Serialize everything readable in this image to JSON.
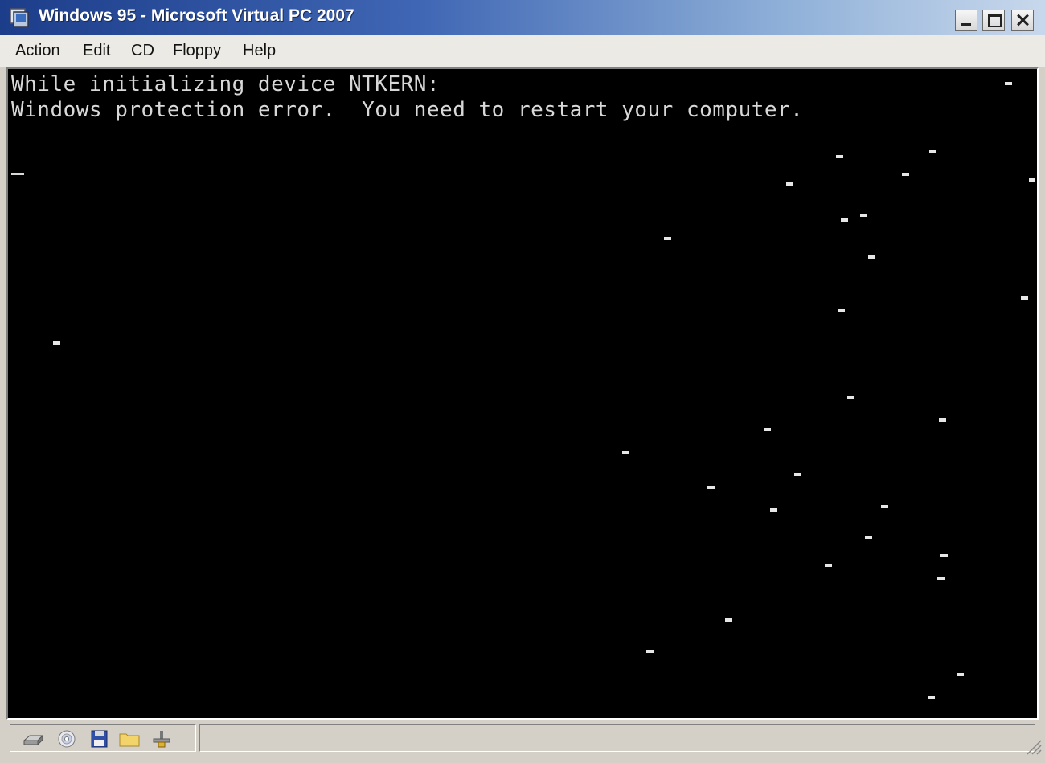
{
  "window": {
    "title": "Windows 95 - Microsoft Virtual PC 2007",
    "icon": "virtual-pc-icon"
  },
  "menu": {
    "items": [
      {
        "label": "Action"
      },
      {
        "label": "Edit"
      },
      {
        "label": "CD"
      },
      {
        "label": "Floppy"
      },
      {
        "label": "Help"
      }
    ]
  },
  "console": {
    "line1": "While initializing device NTKERN:",
    "line2": "Windows protection error.  You need to restart your computer."
  },
  "status": {
    "icons": [
      "hard-disk-icon",
      "cd-icon",
      "floppy-icon",
      "shared-folder-icon",
      "network-icon"
    ]
  },
  "colors": {
    "screen_background": "#000000",
    "console_text": "#d8d8d8",
    "titlebar_start": "#1c3d8a",
    "titlebar_end": "#c8d8ec"
  }
}
